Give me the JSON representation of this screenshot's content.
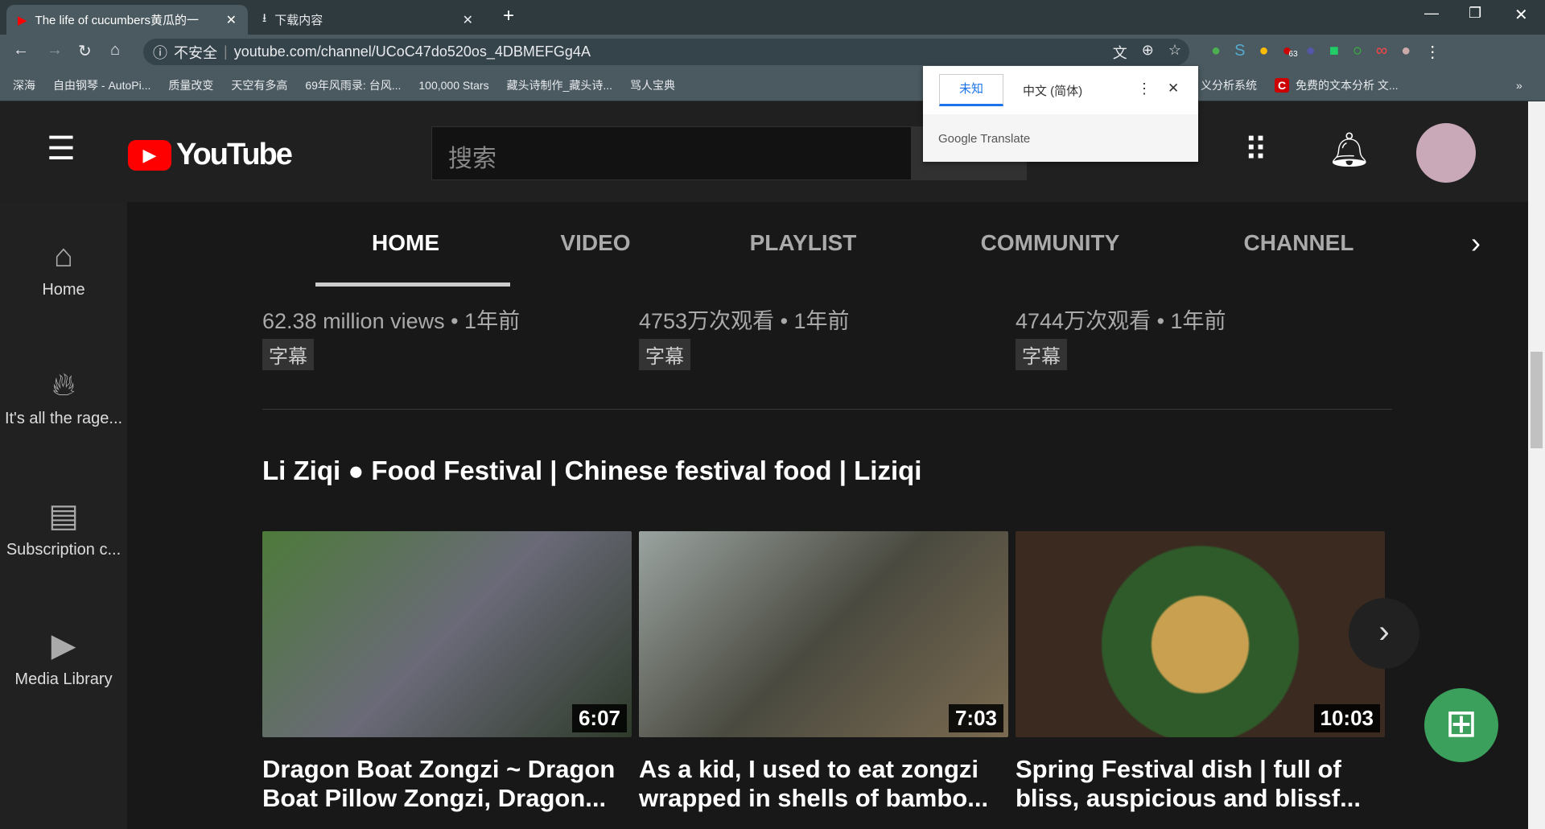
{
  "browser": {
    "tabs": [
      {
        "title": "The life of cucumbers黄瓜的一"
      },
      {
        "title": "下载内容"
      }
    ],
    "new_tab": "+",
    "security": "不安全",
    "url": "youtube.com/channel/UCoC47do520os_4DBMEFGg4A",
    "bookmarks": [
      "深海",
      "自由钢琴 - AutoPi...",
      "质量改变",
      "天空有多高",
      "69年风雨录: 台风...",
      "100,000 Stars",
      "藏头诗制作_藏头诗...",
      "骂人宝典",
      "义分析系统",
      "免费的文本分析 文..."
    ],
    "more_bookmarks": "»",
    "extension_badge": "63"
  },
  "translate_popup": {
    "source": "未知",
    "target": "中文 (简体)",
    "footer": "Google Translate"
  },
  "header": {
    "logo": "YouTube",
    "search_placeholder": "搜索"
  },
  "sidebar": {
    "items": [
      {
        "label": "Home",
        "icon": "home-icon"
      },
      {
        "label": "It's all the rage...",
        "icon": "fire-icon"
      },
      {
        "label": "Subscription c...",
        "icon": "subscriptions-icon"
      },
      {
        "label": "Media Library",
        "icon": "library-icon"
      }
    ]
  },
  "channel_tabs": [
    "HOME",
    "VIDEO",
    "PLAYLIST",
    "COMMUNITY",
    "CHANNEL"
  ],
  "active_tab": "HOME",
  "prev_row": [
    {
      "stats": "62.38 million views • 1年前",
      "tag": "字幕"
    },
    {
      "stats": "4753万次观看 • 1年前",
      "tag": "字幕"
    },
    {
      "stats": "4744万次观看 • 1年前",
      "tag": "字幕"
    }
  ],
  "section": {
    "title": "Li Ziqi ● Food Festival | Chinese festival food | Liziqi",
    "videos": [
      {
        "duration": "6:07",
        "title": "Dragon Boat Zongzi ~ Dragon Boat Pillow Zongzi, Dragon..."
      },
      {
        "duration": "7:03",
        "title": "As a kid, I used to eat zongzi wrapped in shells of bambo..."
      },
      {
        "duration": "10:03",
        "title": "Spring Festival dish | full of bliss, auspicious and blissf..."
      }
    ]
  }
}
